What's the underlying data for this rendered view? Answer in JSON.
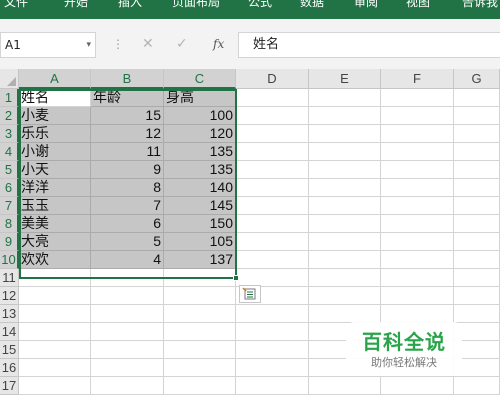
{
  "ribbon": {
    "tabs": [
      "文件",
      "开始",
      "插入",
      "页面布局",
      "公式",
      "数据",
      "审阅",
      "视图",
      "告诉我"
    ]
  },
  "formula_bar": {
    "name_box": "A1",
    "fx_label": "fx",
    "cancel_glyph": "✕",
    "enter_glyph": "✓",
    "separator": "⋮",
    "dropdown_glyph": "▾",
    "formula": "姓名"
  },
  "sheet": {
    "columns": [
      "A",
      "B",
      "C",
      "D",
      "E",
      "F",
      "G"
    ],
    "rows": [
      "1",
      "2",
      "3",
      "4",
      "5",
      "6",
      "7",
      "8",
      "9",
      "10",
      "11",
      "12",
      "13",
      "14",
      "15",
      "16",
      "17"
    ],
    "headers": [
      "姓名",
      "年龄",
      "身高"
    ],
    "data": [
      [
        "小麦",
        "15",
        "100"
      ],
      [
        "乐乐",
        "12",
        "120"
      ],
      [
        "小谢",
        "11",
        "135"
      ],
      [
        "小天",
        "9",
        "135"
      ],
      [
        "洋洋",
        "8",
        "140"
      ],
      [
        "玉玉",
        "7",
        "145"
      ],
      [
        "美美",
        "6",
        "150"
      ],
      [
        "大亮",
        "5",
        "105"
      ],
      [
        "欢欢",
        "4",
        "137"
      ]
    ],
    "selection": "A1:C10"
  },
  "quick_analysis_icon": "quick-analysis-icon",
  "watermark": {
    "title": "百科全说",
    "subtitle": "助你轻松解决"
  },
  "colors": {
    "accent": "#217346",
    "selected_fill": "#c6c6c6",
    "watermark_green": "#2aa44a"
  }
}
